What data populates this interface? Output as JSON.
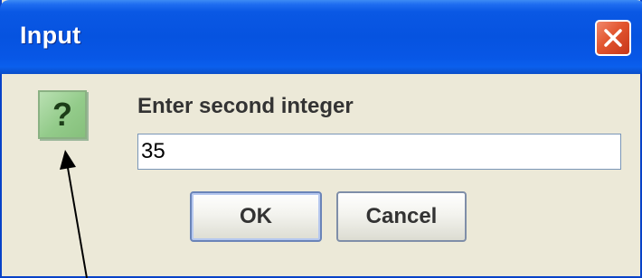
{
  "window": {
    "title": "Input"
  },
  "title_bar": {
    "close_icon": "close-icon"
  },
  "dialog": {
    "icon": "question-icon",
    "icon_glyph": "?",
    "prompt": "Enter second integer",
    "input_value": "35",
    "ok_label": "OK",
    "cancel_label": "Cancel"
  },
  "colors": {
    "title_bar": "#0653e0",
    "dialog_background": "#ece9d8",
    "close_button": "#e2552f",
    "question_icon": "#93cb8a"
  }
}
